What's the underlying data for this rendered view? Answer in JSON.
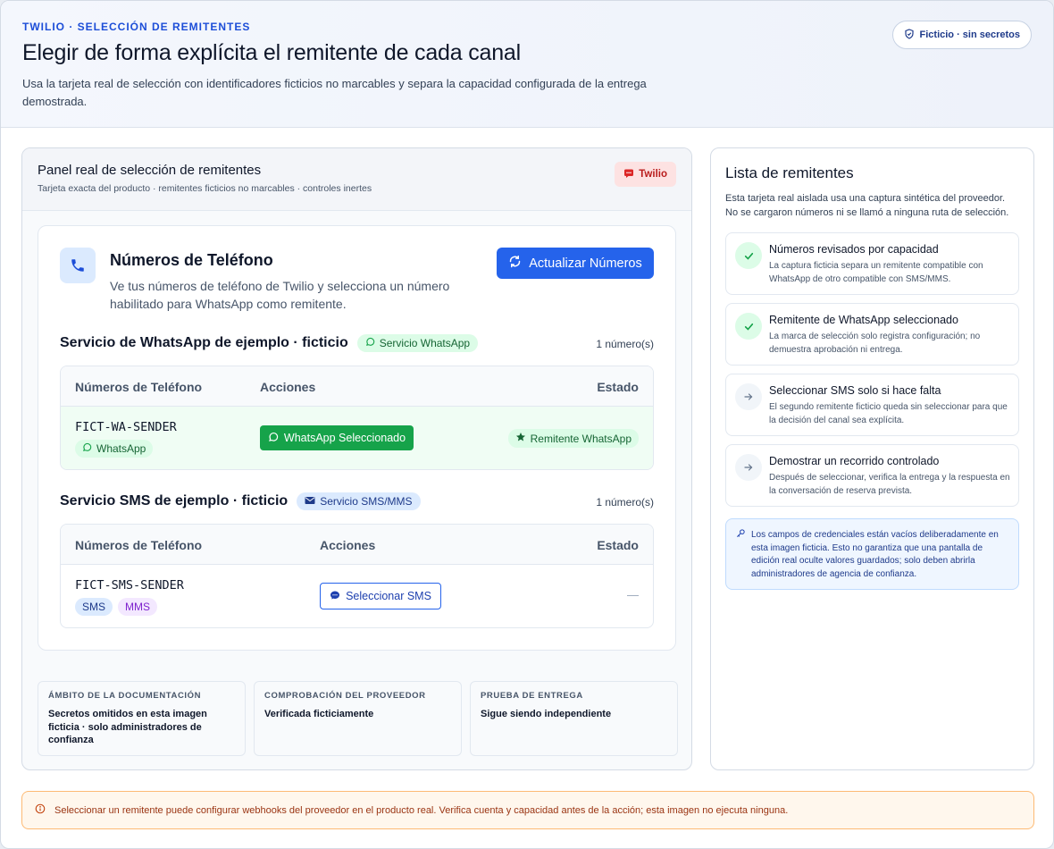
{
  "header": {
    "eyebrow": "TWILIO · SELECCIÓN DE REMITENTES",
    "title": "Elegir de forma explícita el remitente de cada canal",
    "subtitle": "Usa la tarjeta real de selección con identificadores ficticios no marcables y separa la capacidad configurada de la entrega demostrada.",
    "badge": "Ficticio · sin secretos"
  },
  "panel": {
    "title": "Panel real de selección de remitentes",
    "subtitle": "Tarjeta exacta del producto · remitentes ficticios no marcables · controles inertes",
    "brand_badge": "Twilio"
  },
  "card": {
    "title": "Números de Teléfono",
    "description": "Ve tus números de teléfono de Twilio y selecciona un número habilitado para WhatsApp como remitente.",
    "refresh_label": "Actualizar Números",
    "whatsapp_section": {
      "title": "Servicio de WhatsApp de ejemplo · ficticio",
      "pill": "Servicio WhatsApp",
      "count": "1 número(s)",
      "columns": [
        "Números de Teléfono",
        "Acciones",
        "Estado"
      ],
      "row": {
        "sender": "FICT-WA-SENDER",
        "tag": "WhatsApp",
        "action": "WhatsApp Seleccionado",
        "status": "Remitente WhatsApp"
      }
    },
    "sms_section": {
      "title": "Servicio SMS de ejemplo · ficticio",
      "pill": "Servicio SMS/MMS",
      "count": "1 número(s)",
      "columns": [
        "Números de Teléfono",
        "Acciones",
        "Estado"
      ],
      "row": {
        "sender": "FICT-SMS-SENDER",
        "tags": [
          "SMS",
          "MMS"
        ],
        "action": "Seleccionar SMS",
        "status": "—"
      }
    }
  },
  "info_boxes": [
    {
      "label": "ÁMBITO DE LA DOCUMENTACIÓN",
      "value": "Secretos omitidos en esta imagen ficticia · solo administradores de confianza"
    },
    {
      "label": "COMPROBACIÓN DEL PROVEEDOR",
      "value": "Verificada ficticiamente"
    },
    {
      "label": "PRUEBA DE ENTREGA",
      "value": "Sigue siendo independiente"
    }
  ],
  "sidebar": {
    "title": "Lista de remitentes",
    "description": "Esta tarjeta real aislada usa una captura sintética del proveedor. No se cargaron números ni se llamó a ninguna ruta de selección.",
    "steps": [
      {
        "title": "Números revisados por capacidad",
        "desc": "La captura ficticia separa un remitente compatible con WhatsApp de otro compatible con SMS/MMS.",
        "done": true
      },
      {
        "title": "Remitente de WhatsApp seleccionado",
        "desc": "La marca de selección solo registra configuración; no demuestra aprobación ni entrega.",
        "done": true
      },
      {
        "title": "Seleccionar SMS solo si hace falta",
        "desc": "El segundo remitente ficticio queda sin seleccionar para que la decisión del canal sea explícita.",
        "done": false
      },
      {
        "title": "Demostrar un recorrido controlado",
        "desc": "Después de seleccionar, verifica la entrega y la respuesta en la conversación de reserva prevista.",
        "done": false
      }
    ],
    "note": "Los campos de credenciales están vacíos deliberadamente en esta imagen ficticia. Esto no garantiza que una pantalla de edición real oculte valores guardados; solo deben abrirla administradores de agencia de confianza."
  },
  "warning": "Seleccionar un remitente puede configurar webhooks del proveedor en el producto real. Verifica cuenta y capacidad antes de la acción; esta imagen no ejecuta ninguna.",
  "colors": {
    "accent": "#2563eb",
    "whatsapp": "#16a34a",
    "brand": "#b91c1c",
    "warning": "#9a3412"
  }
}
